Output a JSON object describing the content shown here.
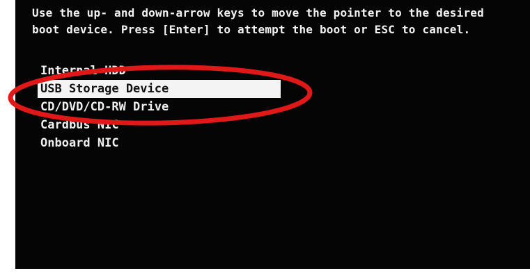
{
  "instructions": {
    "line1": "Use the up- and down-arrow keys to move the pointer to the desired",
    "line2": "boot device. Press [Enter] to attempt the boot or ESC to cancel."
  },
  "boot_menu": {
    "items": [
      {
        "label": "Internal HDD",
        "selected": false
      },
      {
        "label": "USB Storage Device",
        "selected": true
      },
      {
        "label": "CD/DVD/CD-RW Drive",
        "selected": false
      },
      {
        "label": "Cardbus NIC",
        "selected": false
      },
      {
        "label": "Onboard NIC",
        "selected": false
      }
    ]
  },
  "colors": {
    "screen_background": "#050505",
    "text": "#f0f0f0",
    "selection_background": "#f4f4f4",
    "selection_text": "#111111",
    "annotation_ring": "#e01818"
  }
}
